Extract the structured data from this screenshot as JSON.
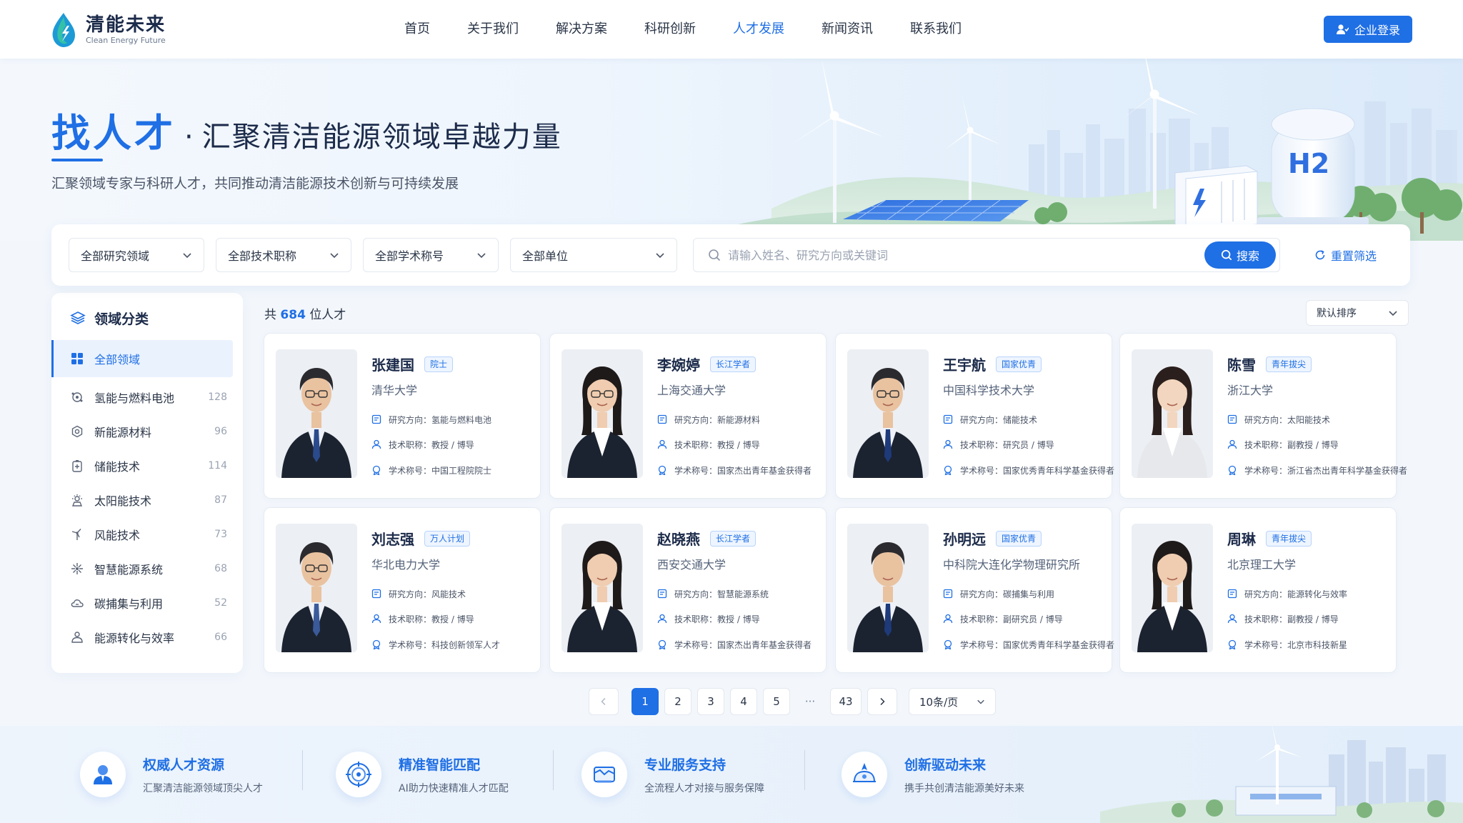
{
  "brand": {
    "name_cn": "清能未来",
    "name_en": "Clean Energy Future",
    "primary_color": "#1f6fe5"
  },
  "nav": {
    "items": [
      "首页",
      "关于我们",
      "解决方案",
      "科研创新",
      "人才发展",
      "新闻资讯",
      "联系我们"
    ],
    "active": "人才发展",
    "login_label": "企业登录"
  },
  "hero": {
    "title_main": "找人才",
    "title_dot": "·",
    "title_rest": "汇聚清洁能源领域卓越力量",
    "subtitle": "汇聚领域专家与科研人才，共同推动清洁能源技术创新与可持续发展",
    "illustration_text": "H2"
  },
  "filters": {
    "selects": [
      "全部研究领域",
      "全部技术职称",
      "全部学术称号",
      "全部单位"
    ],
    "search_placeholder": "请输入姓名、研究方向或关键词",
    "search_label": "搜索",
    "reset_label": "重置筛选"
  },
  "sidebar": {
    "title": "领域分类",
    "items": [
      {
        "label": "全部领域",
        "count": "",
        "icon": "grid-icon",
        "active": true
      },
      {
        "label": "氢能与燃料电池",
        "count": "128",
        "icon": "hydrogen-icon"
      },
      {
        "label": "新能源材料",
        "count": "96",
        "icon": "material-icon"
      },
      {
        "label": "储能技术",
        "count": "114",
        "icon": "battery-icon"
      },
      {
        "label": "太阳能技术",
        "count": "87",
        "icon": "sun-icon"
      },
      {
        "label": "风能技术",
        "count": "73",
        "icon": "wind-icon"
      },
      {
        "label": "智慧能源系统",
        "count": "68",
        "icon": "network-icon"
      },
      {
        "label": "碳捕集与利用",
        "count": "52",
        "icon": "cloud-icon"
      },
      {
        "label": "能源转化与效率",
        "count": "66",
        "icon": "cycle-icon"
      }
    ]
  },
  "results": {
    "count_prefix": "共",
    "count": "684",
    "count_suffix": "位人才",
    "sort_label": "默认排序"
  },
  "field_labels": {
    "direction": "研究方向：",
    "title": "技术职称：",
    "honor": "学术称号："
  },
  "experts": [
    {
      "name": "张建国",
      "tag": "院士",
      "org": "清华大学",
      "direction": "氢能与燃料电池",
      "title": "教授 / 博导",
      "honor": "中国工程院院士",
      "gender": "male",
      "tie": "#2b4a8c"
    },
    {
      "name": "李婉婷",
      "tag": "长江学者",
      "org": "上海交通大学",
      "direction": "新能源材料",
      "title": "教授 / 博导",
      "honor": "国家杰出青年基金获得者",
      "gender": "female",
      "tie": "#ffffff"
    },
    {
      "name": "王宇航",
      "tag": "国家优青",
      "org": "中国科学技术大学",
      "direction": "储能技术",
      "title": "研究员 / 博导",
      "honor": "国家优秀青年科学基金获得者",
      "gender": "male",
      "tie": "#1e3a7a"
    },
    {
      "name": "陈雪",
      "tag": "青年拔尖",
      "org": "浙江大学",
      "direction": "太阳能技术",
      "title": "副教授 / 博导",
      "honor": "浙江省杰出青年科学基金获得者",
      "gender": "female-light",
      "tie": "#ffffff"
    },
    {
      "name": "刘志强",
      "tag": "万人计划",
      "org": "华北电力大学",
      "direction": "风能技术",
      "title": "教授 / 博导",
      "honor": "科技创新领军人才",
      "gender": "male",
      "tie": "#3a5a9a"
    },
    {
      "name": "赵晓燕",
      "tag": "长江学者",
      "org": "西安交通大学",
      "direction": "智慧能源系统",
      "title": "教授 / 博导",
      "honor": "国家杰出青年基金获得者",
      "gender": "female",
      "tie": "#ffffff"
    },
    {
      "name": "孙明远",
      "tag": "国家优青",
      "org": "中科院大连化学物理研究所",
      "direction": "碳捕集与利用",
      "title": "副研究员 / 博导",
      "honor": "国家优秀青年科学基金获得者",
      "gender": "male",
      "tie": "#1e3a7a"
    },
    {
      "name": "周琳",
      "tag": "青年拔尖",
      "org": "北京理工大学",
      "direction": "能源转化与效率",
      "title": "副教授 / 博导",
      "honor": "北京市科技新星",
      "gender": "female",
      "tie": "#ffffff"
    }
  ],
  "pagination": {
    "pages": [
      "1",
      "2",
      "3",
      "4",
      "5"
    ],
    "ellipsis": "···",
    "last": "43",
    "current": "1",
    "page_size": "10条/页"
  },
  "footer": {
    "items": [
      {
        "title": "权威人才资源",
        "desc": "汇聚清洁能源领域顶尖人才",
        "icon": "expert-icon"
      },
      {
        "title": "精准智能匹配",
        "desc": "AI助力快速精准人才匹配",
        "icon": "target-icon"
      },
      {
        "title": "专业服务支持",
        "desc": "全流程人才对接与服务保障",
        "icon": "service-icon"
      },
      {
        "title": "创新驱动未来",
        "desc": "携手共创清洁能源美好未来",
        "icon": "innovation-icon"
      }
    ]
  }
}
